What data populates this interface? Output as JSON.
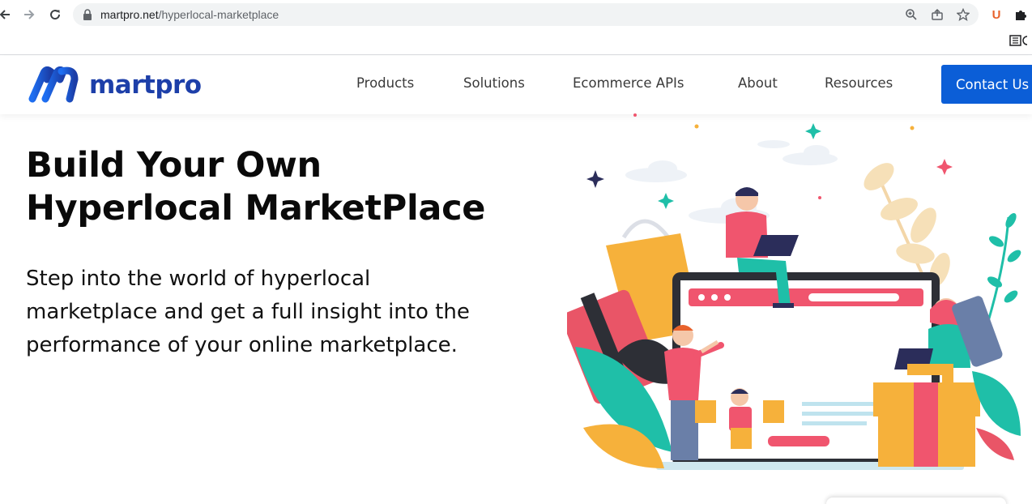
{
  "browser": {
    "url_host": "martpro.net",
    "url_path": "/hyperlocal-marketplace",
    "extension_badge": "U"
  },
  "header": {
    "logo_text": "martpro",
    "nav": [
      "Products",
      "Solutions",
      "Ecommerce APIs",
      "About",
      "Resources"
    ],
    "cta_label": "Contact Us"
  },
  "hero": {
    "title_lines": [
      "Build Your Own",
      "Hyperlocal MarketPlace"
    ],
    "subtitle_lines": [
      "Step into the world of hyperlocal",
      "marketplace and get a full insight into the",
      "performance of your online marketplace."
    ]
  },
  "colors": {
    "brand_blue": "#1d3fa9",
    "cta_blue": "#0b5ed7",
    "accent_pink": "#f0556e",
    "accent_teal": "#1fbfa8",
    "accent_orange": "#f6b13b"
  }
}
